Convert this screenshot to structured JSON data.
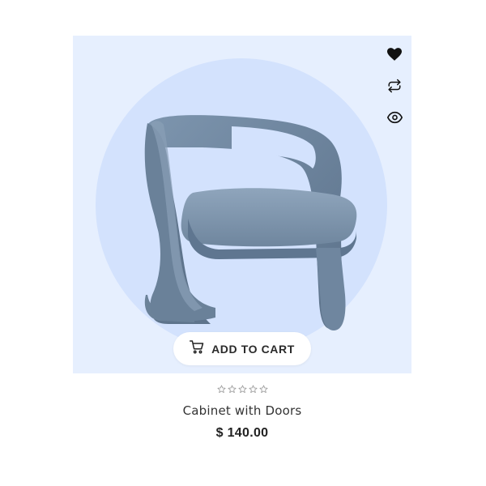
{
  "product": {
    "name": "Cabinet with Doors",
    "price": "$ 140.00",
    "rating": 0,
    "rating_max": 5,
    "image_icon": "armchair-image"
  },
  "actions": {
    "add_to_cart_label": "ADD TO CART",
    "icons": [
      "heart-icon",
      "compare-icon",
      "eye-icon"
    ]
  },
  "colors": {
    "image_bg": "#e6effe",
    "circle": "#d3e2fd",
    "chair": "#7189a4",
    "text_dark": "#222222",
    "star_empty": "#9a9a9a"
  }
}
